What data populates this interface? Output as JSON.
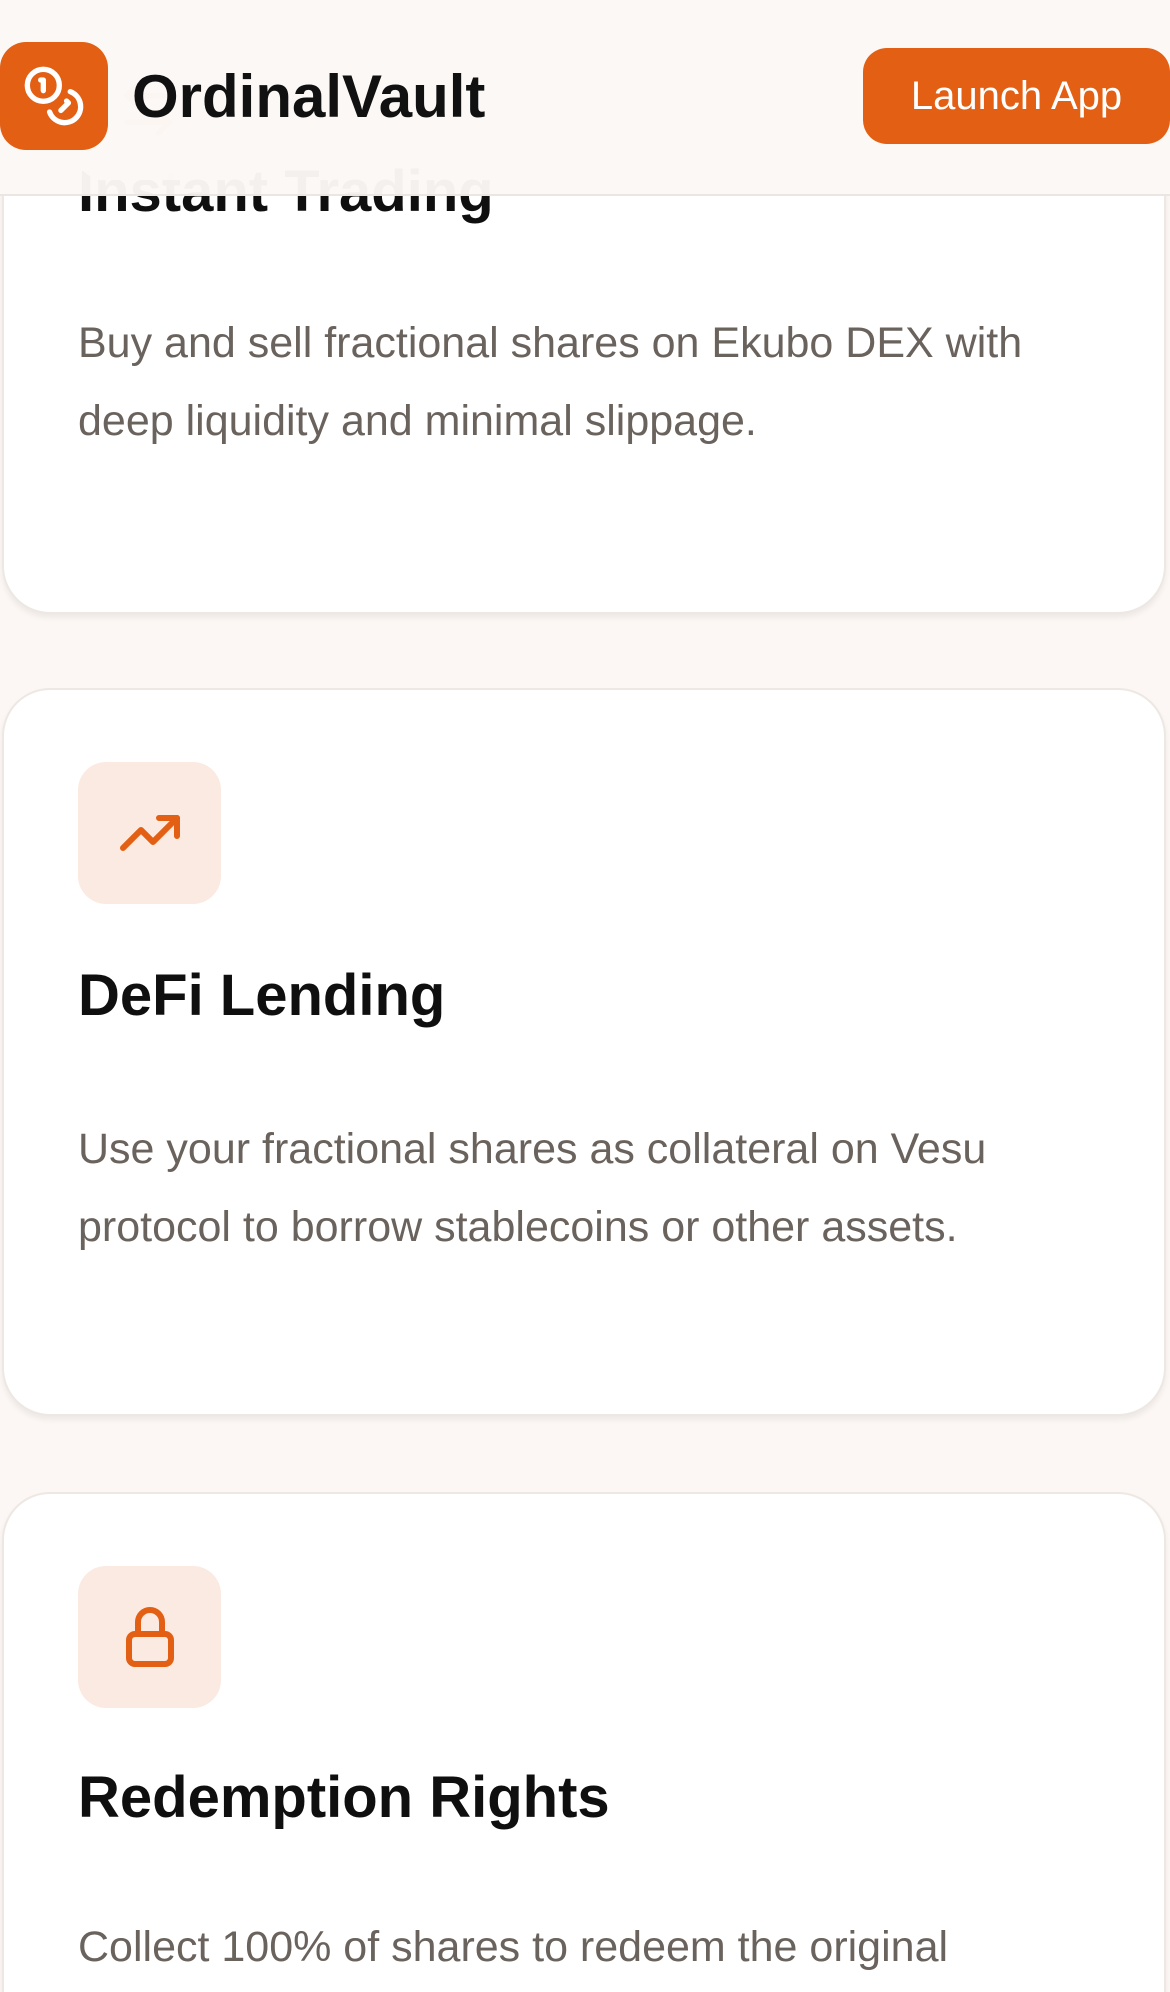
{
  "header": {
    "brand_name": "OrdinalVault",
    "launch_label": "Launch App"
  },
  "features": [
    {
      "title": "Instant Trading",
      "description": "Buy and sell fractional shares on Ekubo DEX with deep liquidity and minimal slippage.",
      "icon": "arrows-exchange-icon"
    },
    {
      "title": "DeFi Lending",
      "description": "Use your fractional shares as collateral on Vesu protocol to borrow stablecoins or other assets.",
      "icon": "trending-up-icon"
    },
    {
      "title": "Redemption Rights",
      "description": "Collect 100% of shares to redeem the original",
      "icon": "lock-icon"
    }
  ],
  "colors": {
    "accent": "#e25f13",
    "icon_bg": "#fbeae1",
    "page_bg": "#fcf7f4",
    "title_text": "#0f0f0f",
    "body_text": "#6a625c"
  }
}
